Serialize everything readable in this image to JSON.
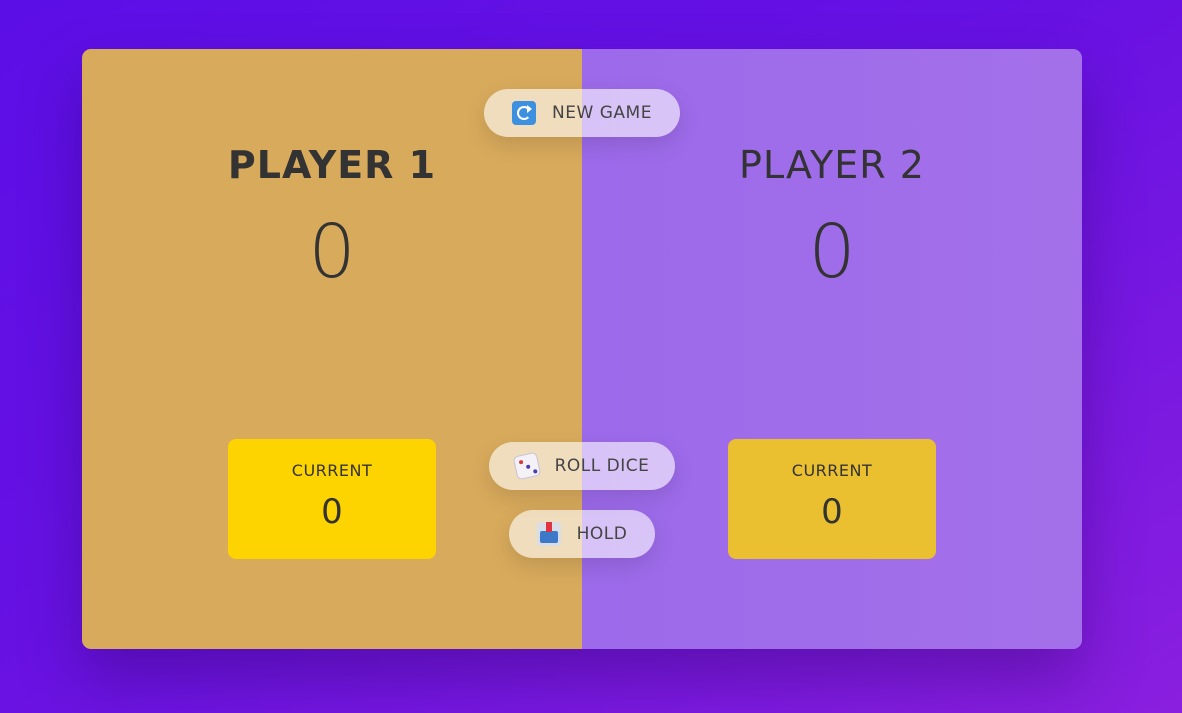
{
  "buttons": {
    "new_game": "NEW GAME",
    "roll_dice": "ROLL DICE",
    "hold": "HOLD"
  },
  "icons": {
    "new_game": "refresh-icon",
    "roll_dice": "dice-icon",
    "hold": "hold-icon"
  },
  "players": [
    {
      "name": "PLAYER 1",
      "score": "0",
      "current_label": "CURRENT",
      "current_score": "0"
    },
    {
      "name": "PLAYER 2",
      "score": "0",
      "current_label": "CURRENT",
      "current_score": "0"
    }
  ],
  "colors": {
    "background": "#6711e3",
    "player1_panel": "#d8aa5c",
    "player2_panel": "#a06ceb",
    "player1_current": "#fdd400",
    "player2_current": "#ebc030"
  }
}
